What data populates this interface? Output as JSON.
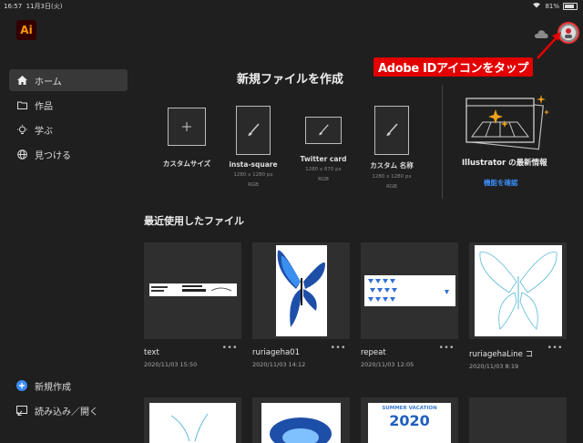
{
  "status": {
    "time": "16:57",
    "date": "11月3日(火)",
    "battery": "81%",
    "battery_level": 0.81
  },
  "app": {
    "logo_text": "Ai"
  },
  "annotation": {
    "text": "Adobe IDアイコンをタップ"
  },
  "sidebar": {
    "items": [
      {
        "label": "ホーム",
        "icon": "home-icon",
        "active": true
      },
      {
        "label": "作品",
        "icon": "folder-icon"
      },
      {
        "label": "学ぶ",
        "icon": "lightbulb-icon"
      },
      {
        "label": "見つける",
        "icon": "globe-icon"
      }
    ],
    "bottom": [
      {
        "label": "新規作成",
        "icon": "plus-circle-icon"
      },
      {
        "label": "読み込み／開く",
        "icon": "import-icon"
      }
    ]
  },
  "create": {
    "title": "新規ファイルを作成",
    "presets": [
      {
        "name": "カスタムサイズ",
        "size": "",
        "mode": ""
      },
      {
        "name": "insta-square",
        "size": "1280 x 1280 px",
        "mode": "RGB"
      },
      {
        "name": "Twitter card",
        "size": "1280 x 670 px",
        "mode": "RGB"
      },
      {
        "name": "カスタム 名称",
        "size": "1280 x 1280 px",
        "mode": "RGB"
      }
    ]
  },
  "news": {
    "title": "Illustrator の最新情報",
    "link": "機能を確認"
  },
  "recent": {
    "title": "最近使用したファイル",
    "files": [
      {
        "name": "text",
        "date": "2020/11/03 15:50"
      },
      {
        "name": "ruriageha01",
        "date": "2020/11/03 14:12"
      },
      {
        "name": "repeat",
        "date": "2020/11/03 12:05"
      },
      {
        "name": "ruriagehaLine コ",
        "date": "2020/11/03 8:19"
      }
    ],
    "second_row": {
      "summer_label": "SUMMER VACATION",
      "year": "2020"
    }
  },
  "colors": {
    "accent": "#3b8cf5",
    "annotation": "#e30000",
    "logo_bg": "#330000",
    "logo_fg": "#ff9a00"
  }
}
